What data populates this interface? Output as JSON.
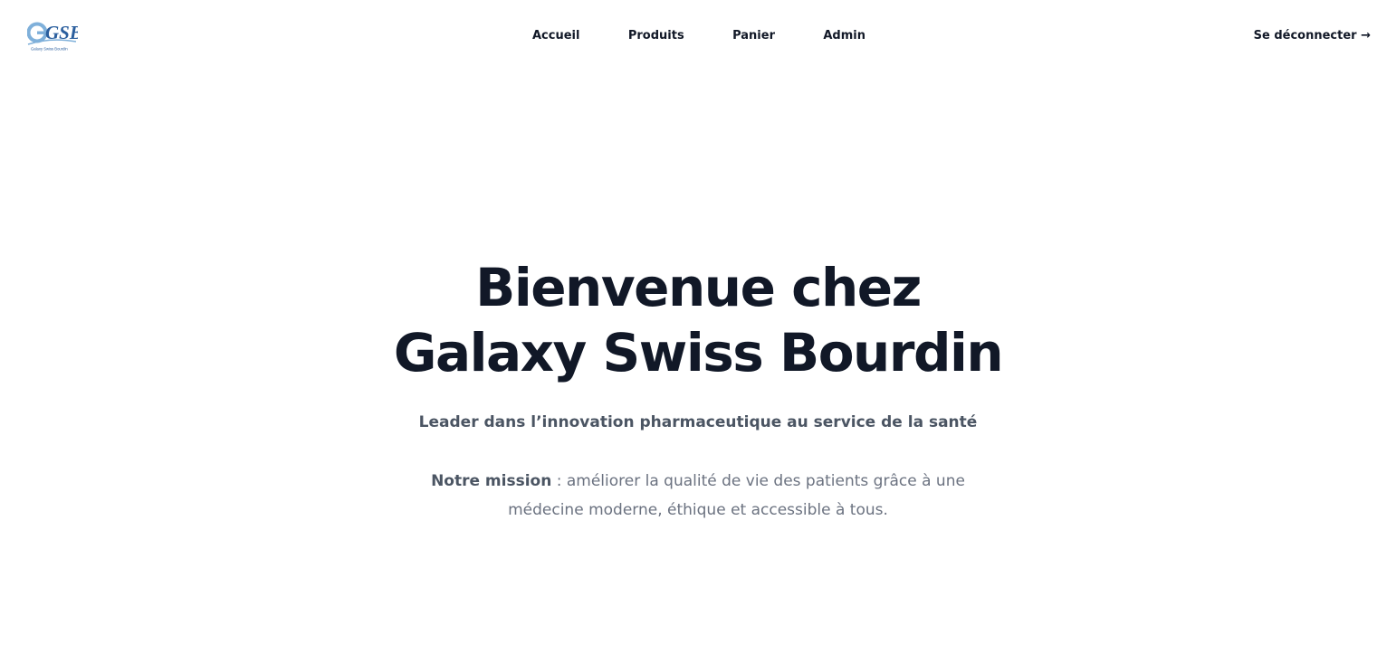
{
  "logo": {
    "initials": "GSB",
    "caption": "Galaxy Swiss Bourdin"
  },
  "nav": {
    "items": [
      {
        "label": "Accueil"
      },
      {
        "label": "Produits"
      },
      {
        "label": "Panier"
      },
      {
        "label": "Admin"
      }
    ],
    "logout_label": "Se déconnecter →"
  },
  "hero": {
    "title_line1": "Bienvenue chez",
    "title_line2": "Galaxy Swiss Bourdin",
    "tagline": "Leader dans l’innovation pharmaceutique au service de la santé",
    "mission_label": "Notre mission",
    "mission_text": " : améliorer la qualité de vie des patients grâce à une médecine moderne, éthique et accessible à tous."
  },
  "colors": {
    "text_primary": "#111827",
    "text_secondary": "#4b5563",
    "text_muted": "#6b7280",
    "logo_blue": "#2b5f9e",
    "logo_light_blue": "#7fb0da",
    "background": "#ffffff"
  }
}
